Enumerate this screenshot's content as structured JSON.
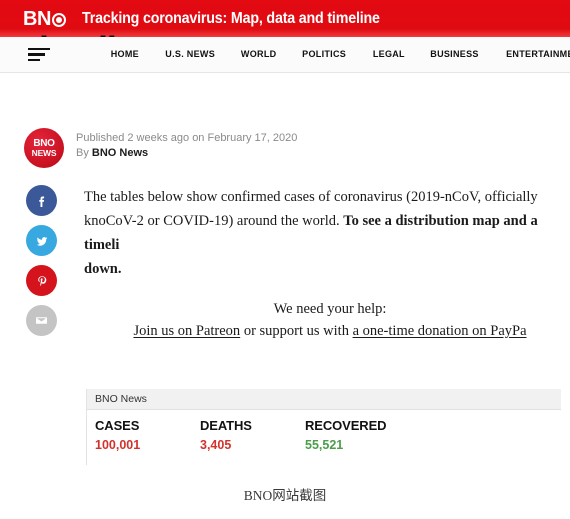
{
  "banner": {
    "logo_text": "BN",
    "logo_mark_icon": "registered-circle-icon",
    "title": "Tracking coronavirus: Map, data and timeline"
  },
  "nav": {
    "menu_icon": "hamburger-menu-icon",
    "links": [
      {
        "label": "HOME"
      },
      {
        "label": "U.S. NEWS"
      },
      {
        "label": "WORLD"
      },
      {
        "label": "POLITICS"
      },
      {
        "label": "LEGAL"
      },
      {
        "label": "BUSINESS"
      },
      {
        "label": "ENTERTAINMENT"
      }
    ]
  },
  "article": {
    "headline_visible": "timeline",
    "byline": {
      "avatar_top": "BNO",
      "avatar_bottom": "NEWS",
      "published": "Published 2 weeks ago on February 17, 2020",
      "by_prefix": "By",
      "author": "BNO News"
    },
    "share": [
      {
        "name": "facebook",
        "label": "f",
        "color": "#3b5998"
      },
      {
        "name": "twitter",
        "label": "t",
        "color": "#38a8e0"
      },
      {
        "name": "pinterest",
        "label": "p",
        "color": "#d5131c"
      },
      {
        "name": "email",
        "label": "m",
        "color": "#c4c4c4"
      }
    ],
    "body": {
      "part1": "The tables below show confirmed cases of coronavirus (2019-nCoV, officially kno",
      "part2": "CoV-2 or COVID-19) around the world. ",
      "part3_bold": "To see a distribution map and a timeli",
      "part4_bold": "down."
    },
    "support": {
      "heading": "We need your help:",
      "link1": "Join us on Patreon",
      "middle": " or support us with ",
      "link2": "a one-time donation on PayPa"
    }
  },
  "stats": {
    "source_title": "BNO News",
    "columns": [
      {
        "label": "CASES",
        "value": "100,001",
        "color": "#d2322d"
      },
      {
        "label": "DEATHS",
        "value": "3,405",
        "color": "#d2322d"
      },
      {
        "label": "RECOVERED",
        "value": "55,521",
        "color": "#4a9d4a"
      }
    ]
  },
  "caption": "BNO网站截图"
}
